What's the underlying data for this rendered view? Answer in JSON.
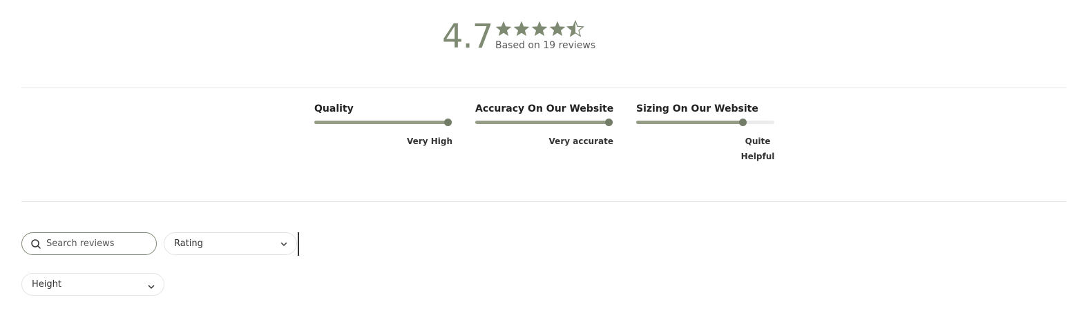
{
  "summary": {
    "average": "4.7",
    "rating_value": 4.7,
    "stars_max": 5,
    "review_count_text": "Based on 19 reviews"
  },
  "attributes": [
    {
      "label": "Quality",
      "value_label": "Very High",
      "level": 1.0
    },
    {
      "label": "Accuracy On Our Website",
      "value_label": "Very accurate",
      "level": 1.0
    },
    {
      "label": "Sizing On Our Website",
      "value_label": "Quite Helpful",
      "value_lines": [
        "Quite",
        "Helpful"
      ],
      "level": 0.8
    }
  ],
  "filters": {
    "search_placeholder": "Search reviews",
    "rating_label": "Rating",
    "height_label": "Height"
  },
  "colors": {
    "accent": "#7f8a73",
    "star": "#7f8a73",
    "bar_fill": "#959d87",
    "bar_track": "#ebebeb",
    "divider": "#e5e5e5"
  },
  "icons": {
    "star": "star-icon",
    "search": "search-icon",
    "dropdown": "chevron-down-icon"
  }
}
